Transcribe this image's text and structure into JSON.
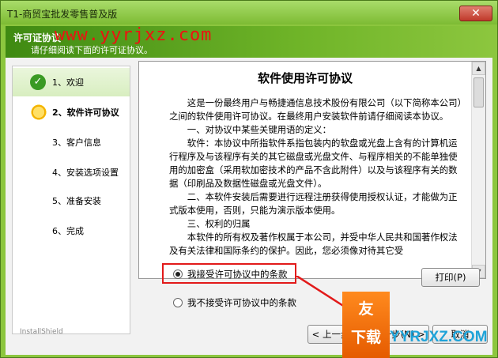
{
  "window": {
    "title": "T1-商贸宝批发零售普及版",
    "close_glyph": "✕"
  },
  "header": {
    "title": "许可证协议",
    "subtitle": "请仔细阅读下面的许可证协议。",
    "watermark": "www.yyrjxz.com"
  },
  "steps": [
    {
      "label": "1、欢迎",
      "state": "done",
      "icon": "check-icon"
    },
    {
      "label": "2、软件许可协议",
      "state": "active",
      "icon": "sun-icon"
    },
    {
      "label": "3、客户信息",
      "state": "pending"
    },
    {
      "label": "4、安装选项设置",
      "state": "pending"
    },
    {
      "label": "5、准备安装",
      "state": "pending"
    },
    {
      "label": "6、完成",
      "state": "pending"
    }
  ],
  "license": {
    "title": "软件使用许可协议",
    "paragraphs": [
      "这是一份最终用户与畅捷通信息技术股份有限公司（以下简称本公司）之间的软件使用许可协议。在最终用户安装软件前请仔细阅读本协议。",
      "一、对协议中某些关键用语的定义：",
      "软件：本协议中所指软件系指包装内的软盘或光盘上含有的计算机运行程序及与该程序有关的其它磁盘或光盘文件、与程序相关的不能单独使用的加密盒（采用软加密技术的产品不含此附件）以及与该程序有关的数据（印刷品及数据性磁盘或光盘文件）。",
      "二、本软件安装后需要进行远程注册获得使用授权认证，才能做为正式版本使用，否则，只能为演示版本使用。",
      "三、权利的归属",
      "本软件的所有权及著作权属于本公司，并受中华人民共和国著作权法及有关法律和国际条约的保护。因此，您必须像对待其它受"
    ]
  },
  "options": {
    "accept": "我接受许可协议中的条款",
    "decline": "我不接受许可协议中的条款",
    "selected": "accept"
  },
  "buttons": {
    "print": "打印(P)",
    "back": "< 上一步(B)",
    "next": "下一步(N) >",
    "cancel": "取消"
  },
  "brand": {
    "installshield": "InstallShield",
    "badge_top": "友",
    "badge_bottom": "下载",
    "site": "YYRJXZ.COM"
  }
}
